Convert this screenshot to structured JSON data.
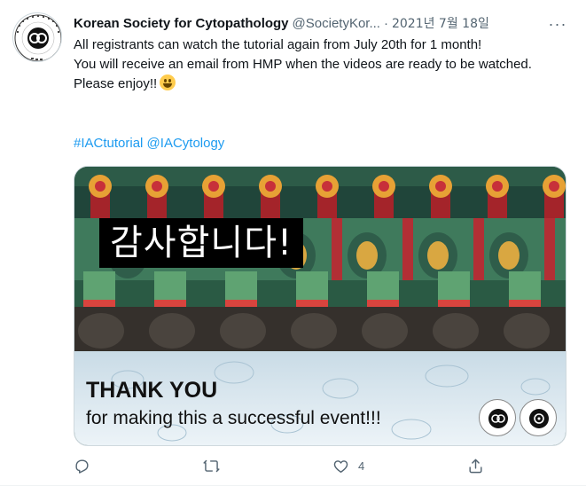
{
  "tweet": {
    "author_name": "Korean Society for Cytopathology",
    "author_handle": "@SocietyKor...",
    "separator": "·",
    "date": "2021년 7월 18일",
    "more_label": "···",
    "lines": [
      "All registrants can watch the tutorial again from July 20th for 1 month!",
      "You will receive an email from HMP when the videos are ready to be watched.",
      "Please enjoy!!"
    ],
    "emoji": "smiling-face-emoji",
    "hashtag": "#IACtutorial",
    "mention": "@IACytology"
  },
  "media": {
    "korean_text": "감사합니다!",
    "thanks_title": "THANK YOU",
    "thanks_subtitle": "for making this a successful event!!!"
  },
  "actions": {
    "reply_icon": "reply-icon",
    "retweet_icon": "retweet-icon",
    "like_icon": "heart-icon",
    "like_count": "4",
    "share_icon": "share-icon"
  },
  "colors": {
    "link": "#1d9bf0",
    "secondary_text": "#536471",
    "primary_text": "#0f1419"
  }
}
